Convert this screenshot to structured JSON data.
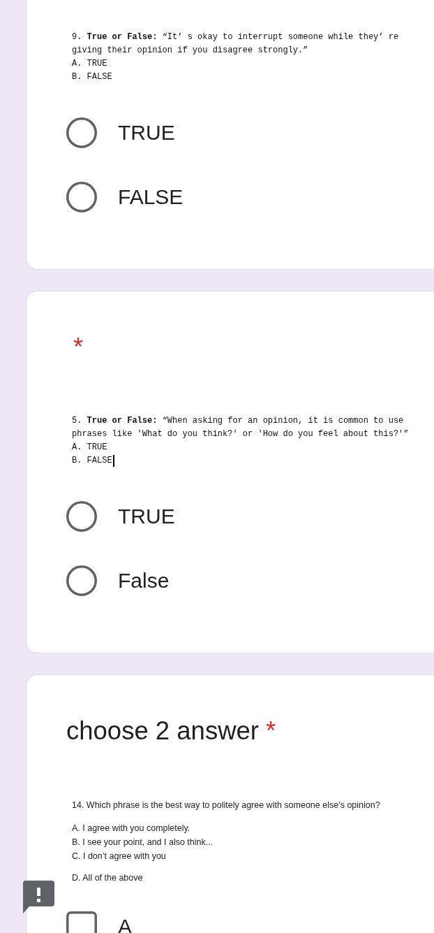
{
  "questions": [
    {
      "kind": "radio",
      "flagged": false,
      "document": {
        "question": "9. **True or False:** “It’ s okay to interrupt someone while they’ re giving their opinion if you disagree strongly.”",
        "options": [
          {
            "text": "A. TRUE",
            "cursor": false
          },
          {
            "text": "B. FALSE",
            "cursor": false
          }
        ]
      },
      "choices": [
        {
          "label": "TRUE",
          "selected": false
        },
        {
          "label": "FALSE",
          "selected": false
        }
      ]
    },
    {
      "kind": "radio",
      "required_mark": "*",
      "flagged": false,
      "document": {
        "question": "5. **True or False:** “When asking for an opinion, it is common to use phrases like 'What do you think?' or 'How do you feel about this?'”",
        "options": [
          {
            "text": "A. TRUE",
            "cursor": false
          },
          {
            "text": "B. FALSE",
            "cursor": true
          }
        ]
      },
      "choices": [
        {
          "label": "TRUE",
          "selected": false
        },
        {
          "label": "False",
          "selected": false
        }
      ]
    },
    {
      "kind": "checkbox",
      "title": "choose 2 answer",
      "required_mark": "*",
      "flagged": true,
      "document": {
        "question": "14. Which phrase is the best way to politely agree with someone else’s opinion?",
        "options": [
          {
            "text": "A. I agree with you completely.",
            "cursor": false
          },
          {
            "text": "B. I see your point, and I also think...",
            "cursor": false
          },
          {
            "text": "C. I don’t agree with you",
            "cursor": false
          },
          {
            "text": "D. All of the above",
            "cursor": false
          }
        ]
      },
      "choices": [
        {
          "label": "A",
          "checked": false
        }
      ]
    }
  ]
}
